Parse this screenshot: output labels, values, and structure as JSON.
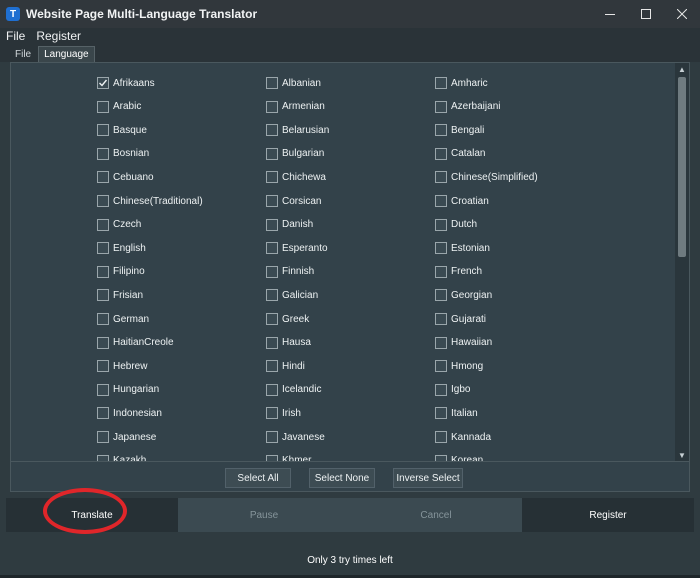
{
  "window": {
    "title": "Website Page Multi-Language Translator",
    "icon": "T"
  },
  "menu": [
    {
      "label": "File"
    },
    {
      "label": "Register"
    }
  ],
  "tabs": [
    {
      "label": "File",
      "active": false
    },
    {
      "label": "Language",
      "active": true
    }
  ],
  "languages": [
    {
      "label": "Afrikaans",
      "checked": true
    },
    {
      "label": "Albanian",
      "checked": false
    },
    {
      "label": "Amharic",
      "checked": false
    },
    {
      "label": "Arabic",
      "checked": false
    },
    {
      "label": "Armenian",
      "checked": false
    },
    {
      "label": "Azerbaijani",
      "checked": false
    },
    {
      "label": "Basque",
      "checked": false
    },
    {
      "label": "Belarusian",
      "checked": false
    },
    {
      "label": "Bengali",
      "checked": false
    },
    {
      "label": "Bosnian",
      "checked": false
    },
    {
      "label": "Bulgarian",
      "checked": false
    },
    {
      "label": "Catalan",
      "checked": false
    },
    {
      "label": "Cebuano",
      "checked": false
    },
    {
      "label": "Chichewa",
      "checked": false
    },
    {
      "label": "Chinese(Simplified)",
      "checked": false
    },
    {
      "label": "Chinese(Traditional)",
      "checked": false
    },
    {
      "label": "Corsican",
      "checked": false
    },
    {
      "label": "Croatian",
      "checked": false
    },
    {
      "label": "Czech",
      "checked": false
    },
    {
      "label": "Danish",
      "checked": false
    },
    {
      "label": "Dutch",
      "checked": false
    },
    {
      "label": "English",
      "checked": false
    },
    {
      "label": "Esperanto",
      "checked": false
    },
    {
      "label": "Estonian",
      "checked": false
    },
    {
      "label": "Filipino",
      "checked": false
    },
    {
      "label": "Finnish",
      "checked": false
    },
    {
      "label": "French",
      "checked": false
    },
    {
      "label": "Frisian",
      "checked": false
    },
    {
      "label": "Galician",
      "checked": false
    },
    {
      "label": "Georgian",
      "checked": false
    },
    {
      "label": "German",
      "checked": false
    },
    {
      "label": "Greek",
      "checked": false
    },
    {
      "label": "Gujarati",
      "checked": false
    },
    {
      "label": "HaitianCreole",
      "checked": false
    },
    {
      "label": "Hausa",
      "checked": false
    },
    {
      "label": "Hawaiian",
      "checked": false
    },
    {
      "label": "Hebrew",
      "checked": false
    },
    {
      "label": "Hindi",
      "checked": false
    },
    {
      "label": "Hmong",
      "checked": false
    },
    {
      "label": "Hungarian",
      "checked": false
    },
    {
      "label": "Icelandic",
      "checked": false
    },
    {
      "label": "Igbo",
      "checked": false
    },
    {
      "label": "Indonesian",
      "checked": false
    },
    {
      "label": "Irish",
      "checked": false
    },
    {
      "label": "Italian",
      "checked": false
    },
    {
      "label": "Japanese",
      "checked": false
    },
    {
      "label": "Javanese",
      "checked": false
    },
    {
      "label": "Kannada",
      "checked": false
    },
    {
      "label": "Kazakh",
      "checked": false
    },
    {
      "label": "Khmer",
      "checked": false
    },
    {
      "label": "Korean",
      "checked": false
    }
  ],
  "selection_buttons": [
    {
      "label": "Select All"
    },
    {
      "label": "Select None"
    },
    {
      "label": "Inverse Select"
    }
  ],
  "actions": [
    {
      "label": "Translate",
      "enabled": true
    },
    {
      "label": "Pause",
      "enabled": false
    },
    {
      "label": "Cancel",
      "enabled": false
    },
    {
      "label": "Register",
      "enabled": true
    }
  ],
  "status": "Only 3 try times left",
  "colors": {
    "background": "#2f3b40",
    "panel": "#33424a",
    "highlight_circle": "#e0262a",
    "app_icon": "#1f6fd1"
  }
}
